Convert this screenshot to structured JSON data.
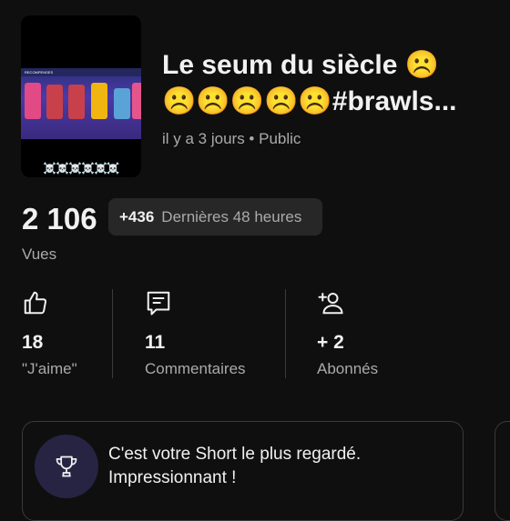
{
  "video": {
    "title_line1": "Le seum du siècle ☹️",
    "title_line2": "☹️☹️☹️☹️☹️#brawls...",
    "meta": "il y a 3 jours • Public",
    "thumbnail": {
      "skulls": "☠️☠️☠️☠️☠️☠️",
      "banner_text": "RECOMPENSES"
    }
  },
  "views": {
    "count": "2 106",
    "label": "Vues",
    "delta_value": "+436",
    "delta_label": "Dernières 48 heures"
  },
  "stats": [
    {
      "icon": "thumbs-up-icon",
      "value": "18",
      "label": "\"J'aime\""
    },
    {
      "icon": "comment-icon",
      "value": "11",
      "label": "Commentaires"
    },
    {
      "icon": "add-subscriber-icon",
      "value": "+ 2",
      "label": "Abonnés"
    }
  ],
  "achievement": {
    "icon": "trophy-icon",
    "line1": "C'est votre Short le plus regardé.",
    "line2": "Impressionnant !"
  },
  "colors": {
    "background": "#0f0f0f",
    "secondary_text": "#aaaaaa",
    "chip_bg": "#272727",
    "badge_bg": "#272443"
  }
}
